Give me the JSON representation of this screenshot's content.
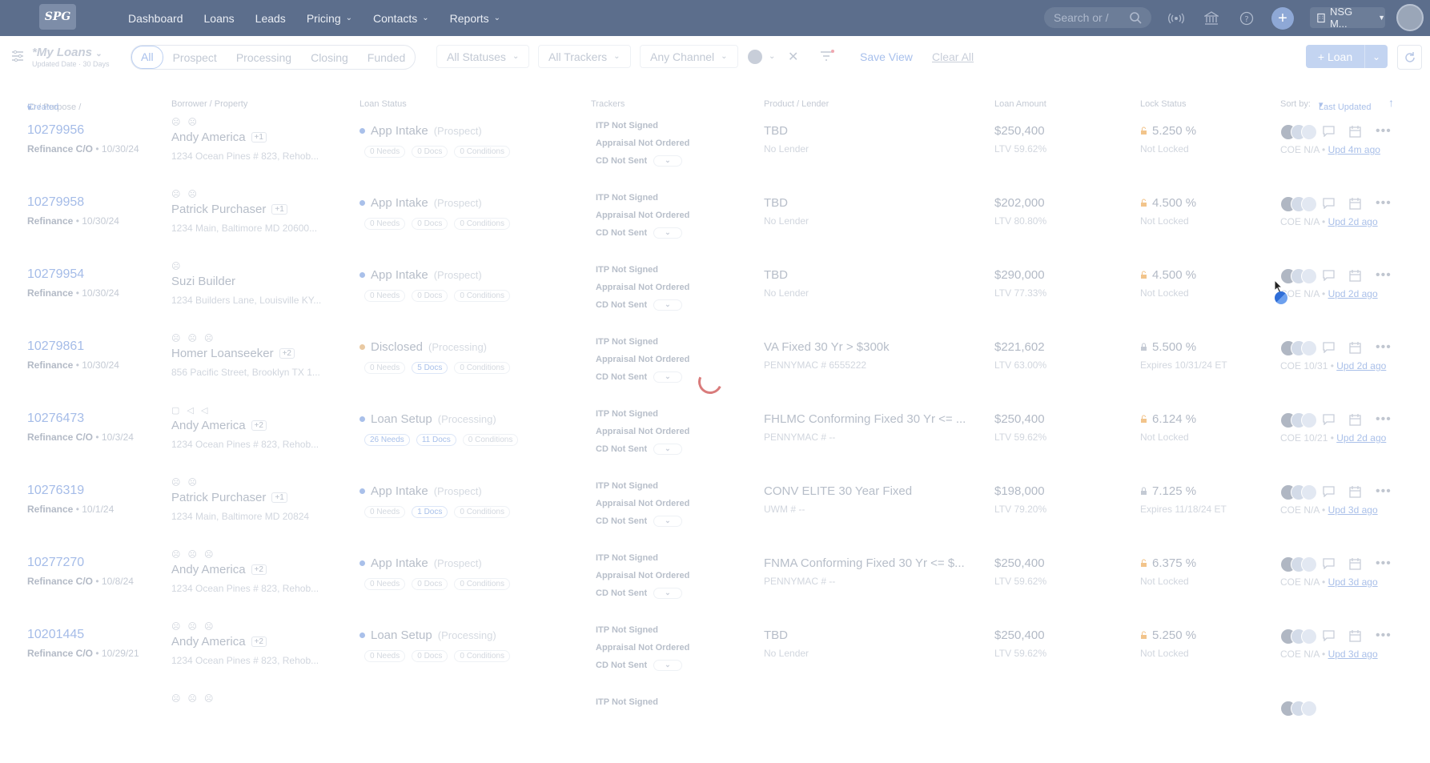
{
  "topbar": {
    "logo": "SPG",
    "nav": [
      {
        "label": "Dashboard",
        "has_menu": false
      },
      {
        "label": "Loans",
        "has_menu": false
      },
      {
        "label": "Leads",
        "has_menu": false
      },
      {
        "label": "Pricing",
        "has_menu": true
      },
      {
        "label": "Contacts",
        "has_menu": true
      },
      {
        "label": "Reports",
        "has_menu": true
      }
    ],
    "search_placeholder": "Search or /",
    "org_label": "NSG M..."
  },
  "filters": {
    "view_title": "*My Loans",
    "view_subtitle": "Updated Date · 30 Days",
    "segments": [
      "All",
      "Prospect",
      "Processing",
      "Closing",
      "Funded"
    ],
    "active_segment": "All",
    "statuses": "All Statuses",
    "trackers": "All Trackers",
    "channel": "Any Channel",
    "save_view": "Save View",
    "clear_all": "Clear All",
    "add_loan": "+ Loan"
  },
  "table": {
    "headers": {
      "id": "ID / Purpose / ",
      "created": "Created",
      "borrower": "Borrower / Property",
      "loan_status": "Loan Status",
      "trackers": "Trackers",
      "product": "Product / Lender",
      "amount": "Loan Amount",
      "lock": "Lock Status",
      "sort_label": "Sort by:",
      "sort_value": "Last Updated"
    },
    "rows": [
      {
        "id": "10279956",
        "purpose": "Refinance C/O",
        "date": " • 10/30/24",
        "faces": "☹ ☹",
        "borrower": "Andy America",
        "extra": "+1",
        "address": "1234 Ocean Pines # 823, Rehob...",
        "status": "App Intake",
        "stage": "(Prospect)",
        "status_color": "#a9c0ea",
        "needs": "0 Needs",
        "docs": "0 Docs",
        "conditions": "0 Conditions",
        "docs_hl": false,
        "needs_hl": false,
        "tracker1": "ITP Not Signed",
        "tracker2": "Appraisal Not Ordered",
        "tracker3": "CD Not Sent",
        "product": "TBD",
        "lender": "No Lender",
        "amount": "$250,400",
        "ltv": "LTV 59.62%",
        "rate": "5.250 %",
        "locked": false,
        "lock_status": "Not Locked",
        "coe": "COE N/A • ",
        "upd": "Upd 4m ago"
      },
      {
        "id": "10279958",
        "purpose": "Refinance",
        "date": " • 10/30/24",
        "faces": "☹ ☹",
        "borrower": "Patrick Purchaser",
        "extra": "+1",
        "address": "1234 Main, Baltimore MD 20600...",
        "status": "App Intake",
        "stage": "(Prospect)",
        "status_color": "#a9c0ea",
        "needs": "0 Needs",
        "docs": "0 Docs",
        "conditions": "0 Conditions",
        "docs_hl": false,
        "needs_hl": false,
        "tracker1": "ITP Not Signed",
        "tracker2": "Appraisal Not Ordered",
        "tracker3": "CD Not Sent",
        "product": "TBD",
        "lender": "No Lender",
        "amount": "$202,000",
        "ltv": "LTV 80.80%",
        "rate": "4.500 %",
        "locked": false,
        "lock_status": "Not Locked",
        "coe": "COE N/A • ",
        "upd": "Upd 2d ago"
      },
      {
        "id": "10279954",
        "purpose": "Refinance",
        "date": " • 10/30/24",
        "faces": "☹",
        "borrower": "Suzi Builder",
        "extra": "",
        "address": "1234 Builders Lane, Louisville KY...",
        "status": "App Intake",
        "stage": "(Prospect)",
        "status_color": "#a9c0ea",
        "needs": "0 Needs",
        "docs": "0 Docs",
        "conditions": "0 Conditions",
        "docs_hl": false,
        "needs_hl": false,
        "tracker1": "ITP Not Signed",
        "tracker2": "Appraisal Not Ordered",
        "tracker3": "CD Not Sent",
        "product": "TBD",
        "lender": "No Lender",
        "amount": "$290,000",
        "ltv": "LTV 77.33%",
        "rate": "4.500 %",
        "locked": false,
        "lock_status": "Not Locked",
        "coe": "COE N/A • ",
        "upd": "Upd 2d ago"
      },
      {
        "id": "10279861",
        "purpose": "Refinance",
        "date": " • 10/30/24",
        "faces": "☹ ☹ ☹",
        "borrower": "Homer Loanseeker",
        "extra": "+2",
        "address": "856 Pacific Street, Brooklyn TX 1...",
        "status": "Disclosed",
        "stage": "(Processing)",
        "status_color": "#e9c9a2",
        "needs": "0 Needs",
        "docs": "5 Docs",
        "conditions": "0 Conditions",
        "docs_hl": true,
        "needs_hl": false,
        "tracker1": "ITP Not Signed",
        "tracker2": "Appraisal Not Ordered",
        "tracker3": "CD Not Sent",
        "product": "VA Fixed 30 Yr > $300k",
        "lender": "PENNYMAC # 6555222",
        "amount": "$221,602",
        "ltv": "LTV 63.00%",
        "rate": "5.500 %",
        "locked": true,
        "lock_status": "Expires 10/31/24 ET",
        "coe": "COE 10/31 • ",
        "upd": "Upd 2d ago"
      },
      {
        "id": "10276473",
        "purpose": "Refinance C/O",
        "date": " • 10/3/24",
        "faces": "▢ ◁ ◁",
        "borrower": "Andy America",
        "extra": "+2",
        "address": "1234 Ocean Pines # 823, Rehob...",
        "status": "Loan Setup",
        "stage": "(Processing)",
        "status_color": "#a9c0ea",
        "needs": "26 Needs",
        "docs": "11 Docs",
        "conditions": "0 Conditions",
        "docs_hl": true,
        "needs_hl": true,
        "tracker1": "ITP Not Signed",
        "tracker2": "Appraisal Not Ordered",
        "tracker3": "CD Not Sent",
        "product": "FHLMC Conforming Fixed 30 Yr <= ...",
        "lender": "PENNYMAC # --",
        "amount": "$250,400",
        "ltv": "LTV 59.62%",
        "rate": "6.124 %",
        "locked": false,
        "lock_status": "Not Locked",
        "coe": "COE 10/21 • ",
        "upd": "Upd 2d ago"
      },
      {
        "id": "10276319",
        "purpose": "Refinance",
        "date": " • 10/1/24",
        "faces": "☹ ☹",
        "borrower": "Patrick Purchaser",
        "extra": "+1",
        "address": "1234 Main, Baltimore MD 20824",
        "status": "App Intake",
        "stage": "(Prospect)",
        "status_color": "#a9c0ea",
        "needs": "0 Needs",
        "docs": "1 Docs",
        "conditions": "0 Conditions",
        "docs_hl": true,
        "needs_hl": false,
        "tracker1": "ITP Not Signed",
        "tracker2": "Appraisal Not Ordered",
        "tracker3": "CD Not Sent",
        "product": "CONV ELITE 30 Year Fixed",
        "lender": "UWM # --",
        "amount": "$198,000",
        "ltv": "LTV 79.20%",
        "rate": "7.125 %",
        "locked": true,
        "lock_status": "Expires 11/18/24 ET",
        "coe": "COE N/A • ",
        "upd": "Upd 3d ago"
      },
      {
        "id": "10277270",
        "purpose": "Refinance C/O",
        "date": " • 10/8/24",
        "faces": "☹ ☹ ☹",
        "borrower": "Andy America",
        "extra": "+2",
        "address": "1234 Ocean Pines # 823, Rehob...",
        "status": "App Intake",
        "stage": "(Prospect)",
        "status_color": "#a9c0ea",
        "needs": "0 Needs",
        "docs": "0 Docs",
        "conditions": "0 Conditions",
        "docs_hl": false,
        "needs_hl": false,
        "tracker1": "ITP Not Signed",
        "tracker2": "Appraisal Not Ordered",
        "tracker3": "CD Not Sent",
        "product": "FNMA Conforming Fixed 30 Yr <= $...",
        "lender": "PENNYMAC # --",
        "amount": "$250,400",
        "ltv": "LTV 59.62%",
        "rate": "6.375 %",
        "locked": false,
        "lock_status": "Not Locked",
        "coe": "COE N/A • ",
        "upd": "Upd 3d ago"
      },
      {
        "id": "10201445",
        "purpose": "Refinance C/O",
        "date": " • 10/29/21",
        "faces": "☹ ☹ ☹",
        "borrower": "Andy America",
        "extra": "+2",
        "address": "1234 Ocean Pines # 823, Rehob...",
        "status": "Loan Setup",
        "stage": "(Processing)",
        "status_color": "#a9c0ea",
        "needs": "0 Needs",
        "docs": "0 Docs",
        "conditions": "0 Conditions",
        "docs_hl": false,
        "needs_hl": false,
        "tracker1": "ITP Not Signed",
        "tracker2": "Appraisal Not Ordered",
        "tracker3": "CD Not Sent",
        "product": "TBD",
        "lender": "No Lender",
        "amount": "$250,400",
        "ltv": "LTV 59.62%",
        "rate": "5.250 %",
        "locked": false,
        "lock_status": "Not Locked",
        "coe": "COE N/A • ",
        "upd": "Upd 3d ago"
      },
      {
        "id": "",
        "purpose": "",
        "date": "",
        "faces": "☹ ☹ ☹",
        "borrower": "",
        "extra": "",
        "address": "",
        "status": "",
        "stage": "",
        "status_color": "#ffffff",
        "needs": "",
        "docs": "",
        "conditions": "",
        "docs_hl": false,
        "needs_hl": false,
        "tracker1": "ITP Not Signed",
        "tracker2": "",
        "tracker3": "",
        "product": "",
        "lender": "",
        "amount": "",
        "ltv": "",
        "rate": "",
        "locked": false,
        "lock_status": "",
        "coe": "",
        "upd": ""
      }
    ]
  }
}
